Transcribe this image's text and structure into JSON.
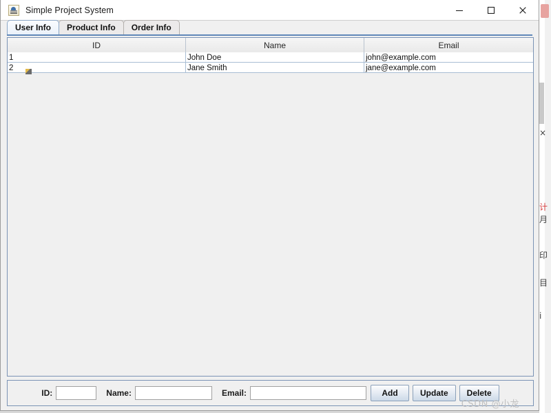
{
  "window": {
    "title": "Simple Project System",
    "app_icon": "java-coffee-cup-icon",
    "controls": {
      "minimize": "minimize-icon",
      "maximize": "maximize-icon",
      "close": "close-icon"
    }
  },
  "tabs": [
    {
      "label": "User Info",
      "selected": true
    },
    {
      "label": "Product Info",
      "selected": false
    },
    {
      "label": "Order Info",
      "selected": false
    }
  ],
  "table": {
    "columns": [
      "ID",
      "Name",
      "Email"
    ],
    "rows": [
      [
        "1",
        "John Doe",
        "john@example.com"
      ],
      [
        "2",
        "Jane Smith",
        "jane@example.com"
      ]
    ]
  },
  "form": {
    "id_label": "ID:",
    "id_value": "",
    "id_placeholder": "",
    "name_label": "Name:",
    "name_value": "",
    "name_placeholder": "",
    "email_label": "Email:",
    "email_value": "",
    "email_placeholder": "",
    "buttons": {
      "add": "Add",
      "update": "Update",
      "delete": "Delete"
    }
  },
  "watermark": "CSDN @小龙",
  "background": {
    "glyphs": [
      "×",
      "计",
      "月",
      "印",
      "目",
      "i"
    ]
  },
  "colors": {
    "accent": "#5f87b8",
    "titlebar": "#ffffff",
    "panel": "#f0f0f0",
    "table_grid": "#a8bdd4"
  }
}
